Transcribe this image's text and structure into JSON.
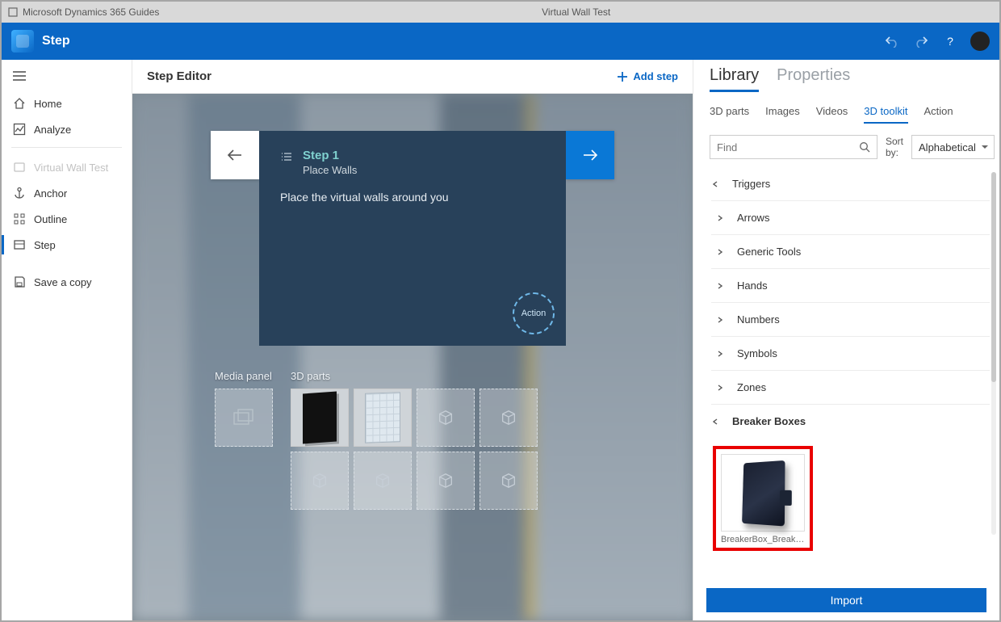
{
  "titlebar": {
    "appName": "Microsoft Dynamics 365 Guides",
    "docTitle": "Virtual Wall Test"
  },
  "header": {
    "breadcrumb": "Step"
  },
  "sidebar": {
    "items": [
      {
        "icon": "home",
        "label": "Home"
      },
      {
        "icon": "analyze",
        "label": "Analyze"
      },
      {
        "icon": "guide",
        "label": "Virtual Wall Test",
        "disabled": true
      },
      {
        "icon": "anchor",
        "label": "Anchor"
      },
      {
        "icon": "outline",
        "label": "Outline"
      },
      {
        "icon": "step",
        "label": "Step",
        "active": true
      },
      {
        "icon": "save",
        "label": "Save a copy"
      }
    ]
  },
  "editor": {
    "title": "Step Editor",
    "addStep": "Add step",
    "card": {
      "stepLabel": "Step 1",
      "stepName": "Place Walls",
      "bodyText": "Place the virtual walls around you",
      "actionChip": "Action"
    },
    "panels": {
      "mediaLabel": "Media panel",
      "partsLabel": "3D parts"
    }
  },
  "library": {
    "tabs": {
      "library": "Library",
      "properties": "Properties"
    },
    "subtabs": [
      "3D parts",
      "Images",
      "Videos",
      "3D toolkit",
      "Action"
    ],
    "activeSubtab": "3D toolkit",
    "find": {
      "placeholder": "Find"
    },
    "sort": {
      "label": "Sort by:",
      "value": "Alphabetical"
    },
    "categories": [
      {
        "name": "Triggers",
        "expanded": true
      },
      {
        "name": "Arrows"
      },
      {
        "name": "Generic Tools"
      },
      {
        "name": "Hands"
      },
      {
        "name": "Numbers"
      },
      {
        "name": "Symbols"
      },
      {
        "name": "Zones"
      },
      {
        "name": "Breaker Boxes",
        "expanded": true,
        "bold": true
      }
    ],
    "breakerItem": "BreakerBox_Breaker_...",
    "importLabel": "Import"
  }
}
